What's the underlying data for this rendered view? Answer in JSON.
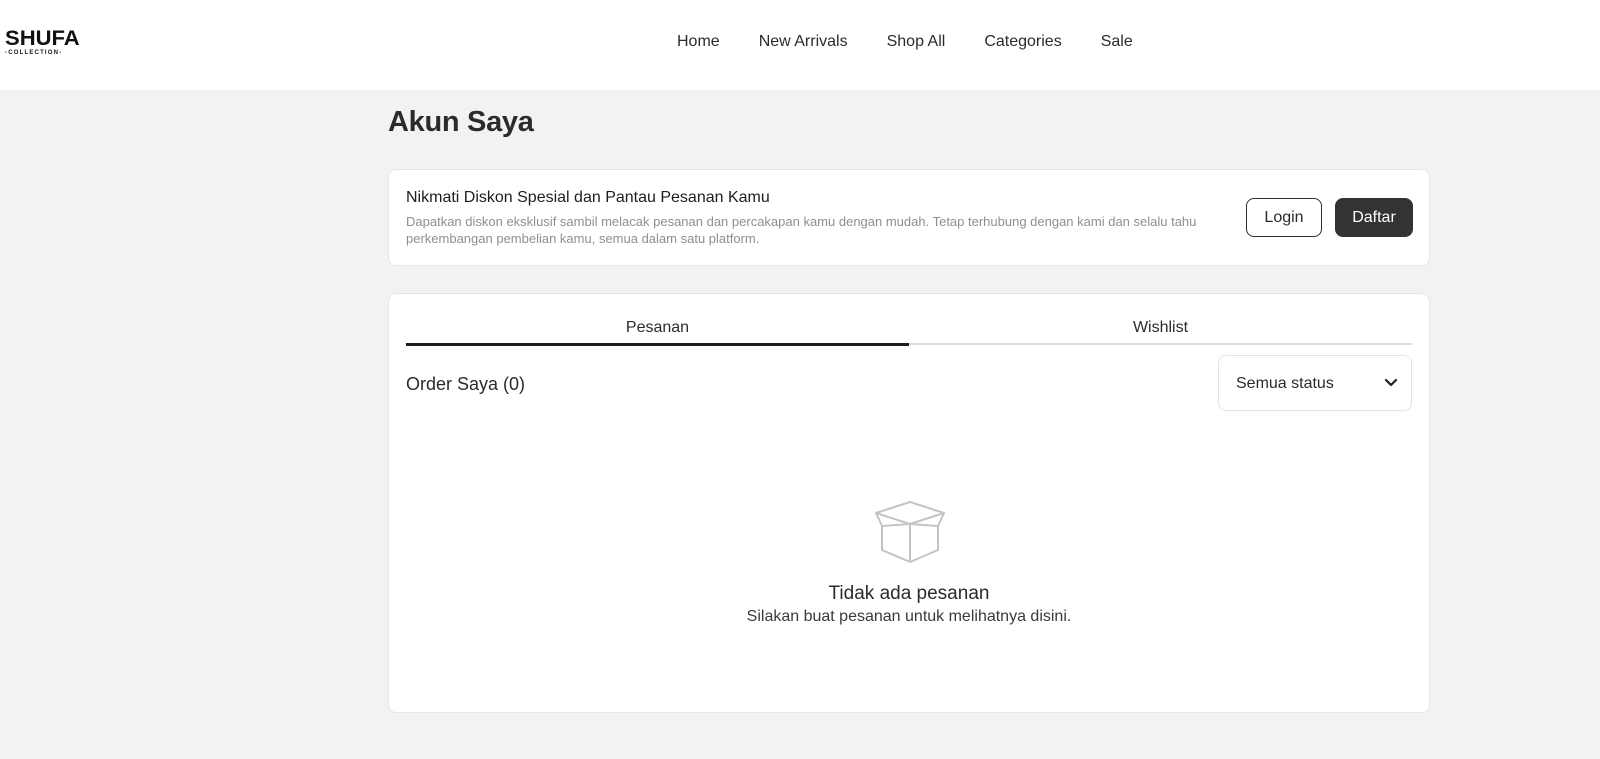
{
  "brand": {
    "name": "SHUFA",
    "subtitle": "COLLECTION"
  },
  "nav": {
    "items": [
      {
        "label": "Home"
      },
      {
        "label": "New Arrivals"
      },
      {
        "label": "Shop All"
      },
      {
        "label": "Categories"
      },
      {
        "label": "Sale"
      }
    ]
  },
  "page": {
    "title": "Akun Saya"
  },
  "promo": {
    "title": "Nikmati Diskon Spesial dan Pantau Pesanan Kamu",
    "description": "Dapatkan diskon eksklusif sambil melacak pesanan dan percakapan kamu dengan mudah. Tetap terhubung dengan kami dan selalu tahu perkembangan pembelian kamu, semua dalam satu platform.",
    "login_label": "Login",
    "register_label": "Daftar"
  },
  "orders": {
    "tabs": [
      {
        "label": "Pesanan",
        "active": true
      },
      {
        "label": "Wishlist",
        "active": false
      }
    ],
    "heading": "Order Saya (0)",
    "status_filter": {
      "selected": "Semua status"
    },
    "empty": {
      "icon": "box-icon",
      "title": "Tidak ada pesanan",
      "subtitle": "Silakan buat pesanan untuk melihatnya disini."
    }
  },
  "colors": {
    "background": "#f2f2f2",
    "primary_button": "#333333",
    "tab_active": "#1e1e1e",
    "tab_inactive_line": "#d6dde6"
  }
}
